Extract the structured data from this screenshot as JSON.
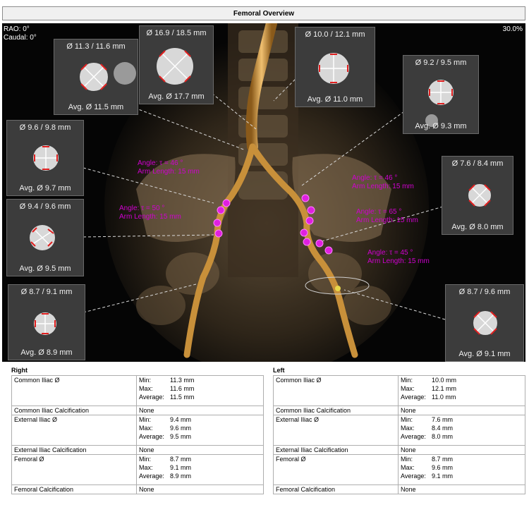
{
  "header": {
    "title": "Femoral Overview"
  },
  "viewer": {
    "rao": "RAO: 0°",
    "caudal": "Caudal: 0°",
    "zoom": "30.0%",
    "cross_sections": [
      {
        "id": "r-common-iliac-a",
        "diam": "Ø 11.3 / 11.6 mm",
        "avg": "Avg. Ø 11.5 mm"
      },
      {
        "id": "aorta",
        "diam": "Ø 16.9 / 18.5 mm",
        "avg": "Avg. Ø 17.7 mm"
      },
      {
        "id": "l-common-iliac-a",
        "diam": "Ø 10.0 / 12.1 mm",
        "avg": "Avg. Ø 11.0 mm"
      },
      {
        "id": "l-common-iliac-b",
        "diam": "Ø 9.2 / 9.5 mm",
        "avg": "Avg. Ø 9.3 mm"
      },
      {
        "id": "r-common-iliac-b",
        "diam": "Ø 9.6 / 9.8 mm",
        "avg": "Avg. Ø 9.7 mm"
      },
      {
        "id": "r-external-iliac",
        "diam": "Ø 9.4 / 9.6 mm",
        "avg": "Avg. Ø 9.5 mm"
      },
      {
        "id": "r-femoral",
        "diam": "Ø 8.7 / 9.1 mm",
        "avg": "Avg. Ø 8.9 mm"
      },
      {
        "id": "l-external-iliac",
        "diam": "Ø 7.6 / 8.4 mm",
        "avg": "Avg. Ø 8.0 mm"
      },
      {
        "id": "l-femoral",
        "diam": "Ø 8.7 / 9.6 mm",
        "avg": "Avg. Ø 9.1 mm"
      }
    ],
    "angles": [
      {
        "angle": "Angle: τ = 46 °",
        "arm": "Arm Length: 15 mm"
      },
      {
        "angle": "Angle: τ = 50 °",
        "arm": "Arm Length: 15 mm"
      },
      {
        "angle": "Angle: τ = 46 °",
        "arm": "Arm Length: 15 mm"
      },
      {
        "angle": "Angle: τ = 65 °",
        "arm": "Arm Length: 15 mm"
      },
      {
        "angle": "Angle: τ = 45 °",
        "arm": "Arm Length: 15 mm"
      }
    ]
  },
  "labels": {
    "min": "Min:",
    "max": "Max:",
    "avg": "Average:"
  },
  "right": {
    "title": "Right",
    "common_iliac": {
      "label": "Common Iliac Ø",
      "min": "11.3 mm",
      "max": "11.6 mm",
      "avg": "11.5 mm"
    },
    "common_iliac_calc": {
      "label": "Common Iliac Calcification",
      "value": "None"
    },
    "external_iliac": {
      "label": "External Iliac Ø",
      "min": "9.4 mm",
      "max": "9.6 mm",
      "avg": "9.5 mm"
    },
    "external_iliac_calc": {
      "label": "External Iliac Calcification",
      "value": "None"
    },
    "femoral": {
      "label": "Femoral Ø",
      "min": "8.7 mm",
      "max": "9.1 mm",
      "avg": "8.9 mm"
    },
    "femoral_calc": {
      "label": "Femoral Calcification",
      "value": "None"
    }
  },
  "left": {
    "title": "Left",
    "common_iliac": {
      "label": "Common Iliac Ø",
      "min": "10.0 mm",
      "max": "12.1 mm",
      "avg": "11.0 mm"
    },
    "common_iliac_calc": {
      "label": "Common Iliac Calcification",
      "value": "None"
    },
    "external_iliac": {
      "label": "External Iliac Ø",
      "min": "7.6 mm",
      "max": "8.4 mm",
      "avg": "8.0 mm"
    },
    "external_iliac_calc": {
      "label": "External Iliac Calcification",
      "value": "None"
    },
    "femoral": {
      "label": "Femoral Ø",
      "min": "8.7 mm",
      "max": "9.6 mm",
      "avg": "9.1 mm"
    },
    "femoral_calc": {
      "label": "Femoral Calcification",
      "value": "None"
    }
  }
}
